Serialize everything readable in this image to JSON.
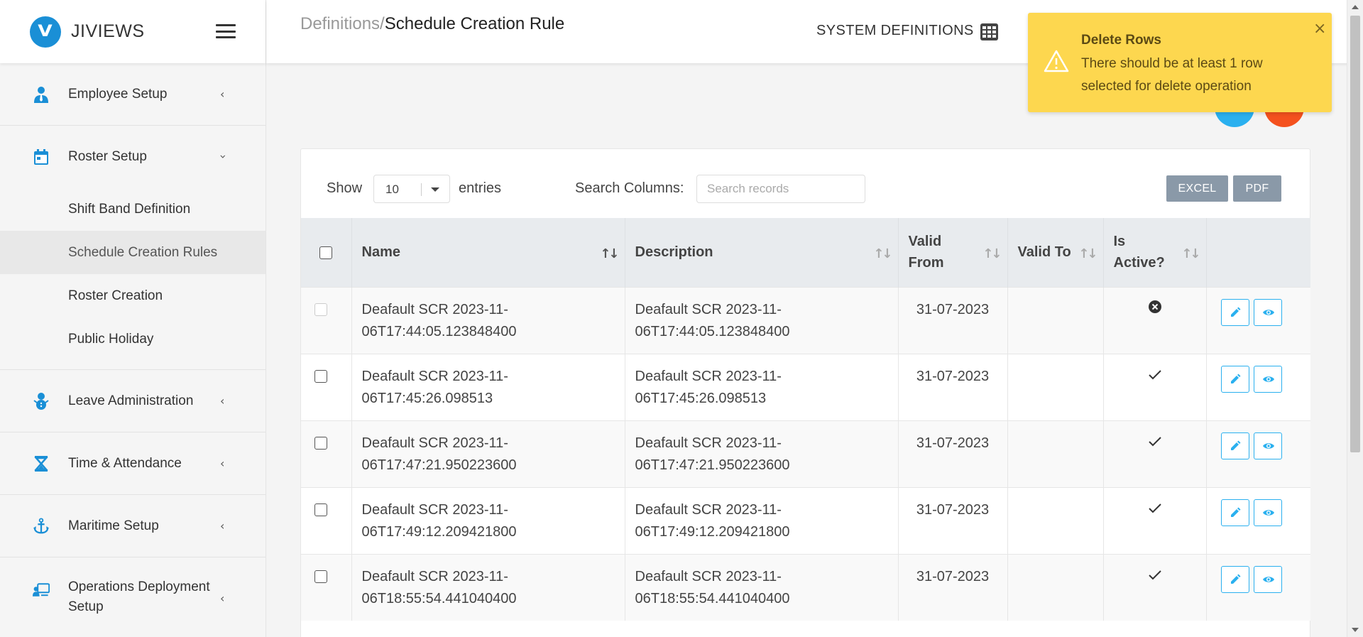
{
  "app": {
    "name": "JIVIEWS",
    "logo_letter": "V"
  },
  "sidebar": {
    "items": [
      {
        "label": "Employee Setup",
        "icon": "employee-icon",
        "expanded": false
      },
      {
        "label": "Roster Setup",
        "icon": "calendar-icon",
        "expanded": true,
        "children": [
          {
            "label": "Shift Band Definition"
          },
          {
            "label": "Schedule Creation Rules",
            "active": true
          },
          {
            "label": "Roster Creation"
          },
          {
            "label": "Public Holiday"
          }
        ]
      },
      {
        "label": "Leave Administration",
        "icon": "snowman-icon",
        "expanded": false
      },
      {
        "label": "Time & Attendance",
        "icon": "hourglass-icon",
        "expanded": false
      },
      {
        "label": "Maritime Setup",
        "icon": "anchor-icon",
        "expanded": false
      },
      {
        "label": "Operations Deployment Setup",
        "icon": "operations-icon",
        "expanded": false
      }
    ]
  },
  "header": {
    "breadcrumb_parent": "Definitions/",
    "breadcrumb_current": "Schedule Creation Rule",
    "system_definitions": "SYSTEM DEFINITIONS"
  },
  "toolbar": {
    "show_label": "Show",
    "page_size": "10",
    "entries_label": "entries",
    "search_label": "Search Columns:",
    "search_placeholder": "Search records",
    "excel_label": "EXCEL",
    "pdf_label": "PDF"
  },
  "table": {
    "headers": [
      "Name",
      "Description",
      "Valid From",
      "Valid To",
      "Is Active?"
    ],
    "rows": [
      {
        "name": "Deafault SCR 2023-11-06T17:44:05.123848400",
        "description": "Deafault SCR 2023-11-06T17:44:05.123848400",
        "valid_from": "31-07-2023",
        "valid_to": "",
        "active": "inactive",
        "checkbox_disabled": true
      },
      {
        "name": "Deafault SCR 2023-11-06T17:45:26.098513",
        "description": "Deafault SCR 2023-11-06T17:45:26.098513",
        "valid_from": "31-07-2023",
        "valid_to": "",
        "active": "active",
        "checkbox_disabled": false
      },
      {
        "name": "Deafault SCR 2023-11-06T17:47:21.950223600",
        "description": "Deafault SCR 2023-11-06T17:47:21.950223600",
        "valid_from": "31-07-2023",
        "valid_to": "",
        "active": "active",
        "checkbox_disabled": false
      },
      {
        "name": "Deafault SCR 2023-11-06T17:49:12.209421800",
        "description": "Deafault SCR 2023-11-06T17:49:12.209421800",
        "valid_from": "31-07-2023",
        "valid_to": "",
        "active": "active",
        "checkbox_disabled": false
      },
      {
        "name": "Deafault SCR 2023-11-06T18:55:54.441040400",
        "description": "Deafault SCR 2023-11-06T18:55:54.441040400",
        "valid_from": "31-07-2023",
        "valid_to": "",
        "active": "active",
        "checkbox_disabled": false
      }
    ]
  },
  "toast": {
    "title": "Delete Rows",
    "message": "There should be at least 1 row selected for delete operation"
  },
  "colors": {
    "accent": "#2ab0ef",
    "danger": "#f4511e",
    "warning": "#fdd74f",
    "brand": "#1a8fd6"
  }
}
